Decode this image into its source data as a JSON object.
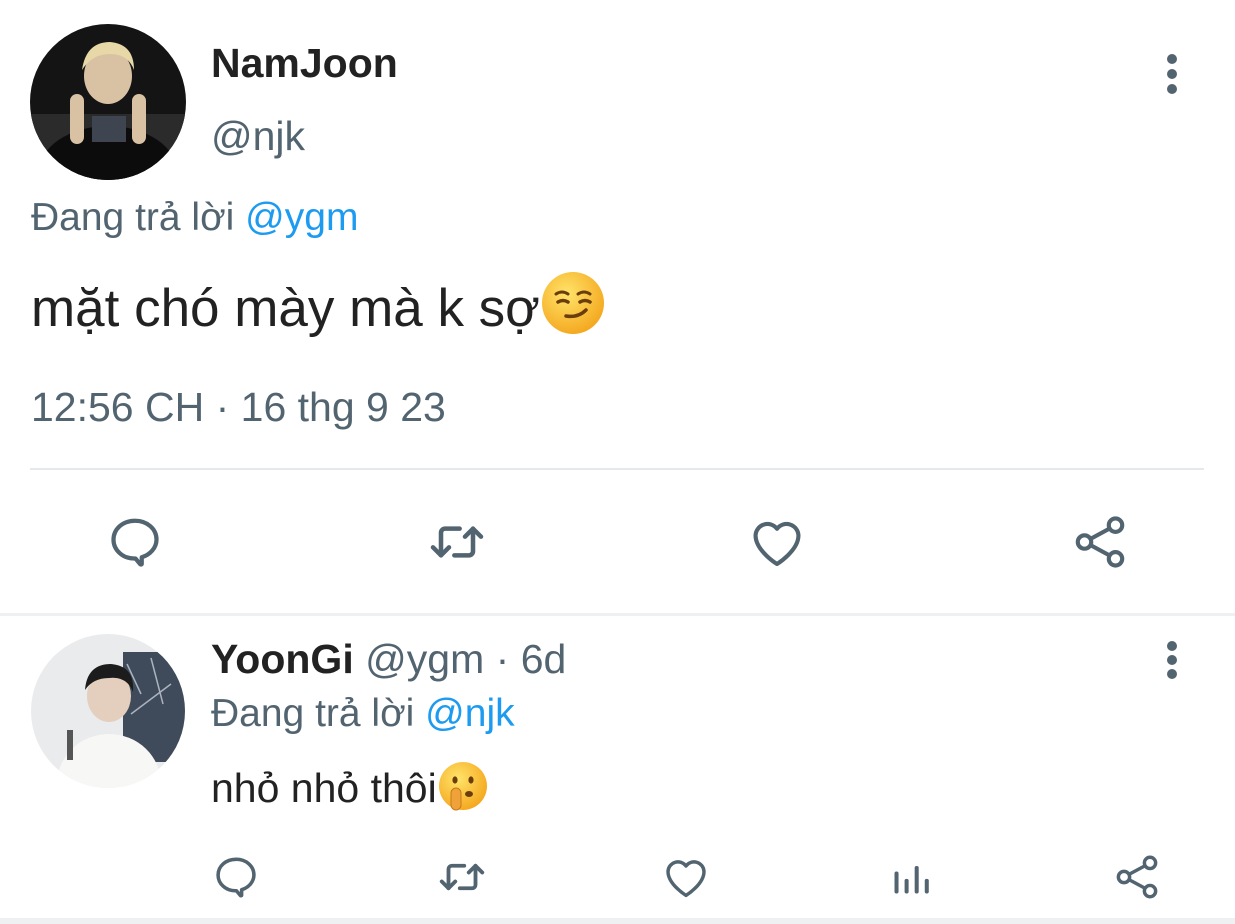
{
  "main_tweet": {
    "author_name": "NamJoon",
    "author_handle": "@njk",
    "replying_prefix": "Đang trả lời",
    "replying_to": "@ygm",
    "text": "mặt chó mày mà k sợ",
    "text_emoji": "smirking-face",
    "timestamp": "12:56 CH · 16 thg 9 23"
  },
  "reply": {
    "author_name": "YoonGi",
    "author_handle": "@ygm",
    "separator": "·",
    "age": "6d",
    "replying_prefix": "Đang trả lời",
    "replying_to": "@njk",
    "text": "nhỏ nhỏ thôi",
    "text_emoji": "shushing-face"
  },
  "icons": {
    "more": "more-vertical-icon",
    "reply": "comment-icon",
    "retweet": "retweet-icon",
    "like": "heart-icon",
    "share": "share-icon",
    "analytics": "analytics-icon"
  },
  "colors": {
    "text": "#222222",
    "muted": "#536471",
    "link": "#1d9bf0",
    "divider": "#e6e9ec"
  }
}
